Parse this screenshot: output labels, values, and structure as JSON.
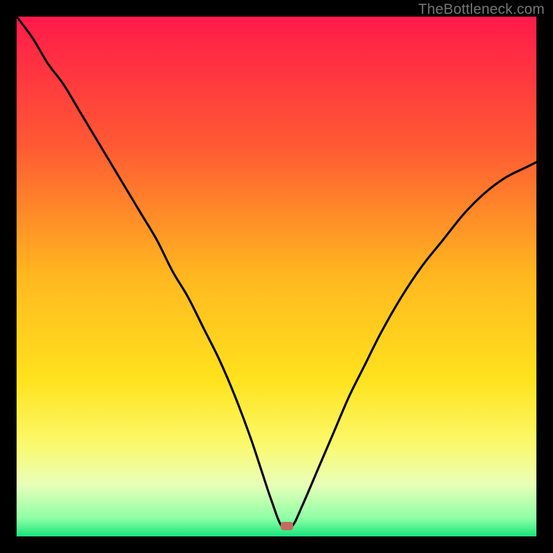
{
  "watermark": "TheBottleneck.com",
  "chart_data": {
    "type": "line",
    "title": "",
    "xlabel": "",
    "ylabel": "",
    "xlim": [
      0,
      100
    ],
    "ylim": [
      0,
      100
    ],
    "gradient_stops": [
      {
        "offset": 0.0,
        "color": "#ff1a4a"
      },
      {
        "offset": 0.25,
        "color": "#ff5a33"
      },
      {
        "offset": 0.5,
        "color": "#ffb81f"
      },
      {
        "offset": 0.7,
        "color": "#ffe21e"
      },
      {
        "offset": 0.82,
        "color": "#fbf96a"
      },
      {
        "offset": 0.9,
        "color": "#e9ffb8"
      },
      {
        "offset": 0.965,
        "color": "#8effa6"
      },
      {
        "offset": 1.0,
        "color": "#18e47a"
      }
    ],
    "series": [
      {
        "name": "bottleneck-curve",
        "x": [
          0,
          3,
          6,
          9,
          12,
          15,
          18,
          21,
          24,
          27,
          30,
          33,
          36,
          39,
          42,
          45,
          47,
          49,
          51,
          53,
          55,
          58,
          61,
          64,
          67,
          70,
          74,
          78,
          82,
          86,
          90,
          94,
          98,
          100
        ],
        "y": [
          100,
          96,
          91,
          87,
          82,
          77,
          72,
          67,
          62,
          57,
          51,
          46,
          40,
          34,
          27,
          19,
          13,
          7,
          2,
          2,
          6,
          13,
          20,
          27,
          33,
          39,
          46,
          52,
          57,
          62,
          66,
          69,
          71,
          72
        ]
      }
    ],
    "marker": {
      "x": 52,
      "y": 2,
      "color": "#c46a5f"
    }
  }
}
